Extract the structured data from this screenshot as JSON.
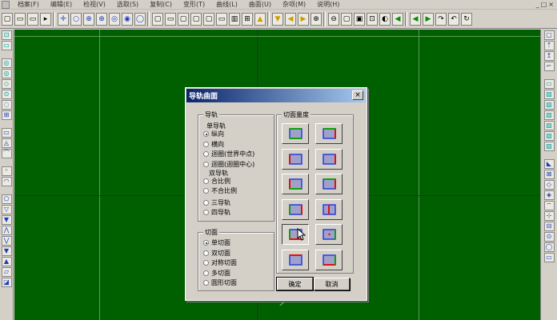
{
  "menu": {
    "items": [
      "档案(F)",
      "编辑(E)",
      "检视(V)",
      "选取(S)",
      "复制(C)",
      "变形(T)",
      "曲线(L)",
      "曲面(U)",
      "杂项(M)",
      "说明(H)"
    ],
    "window_controls": [
      "_",
      "□",
      "×"
    ]
  },
  "toolbar": {
    "buttons": [
      "▢",
      "▭",
      "▭",
      "▸",
      "✛",
      "○",
      "⊕",
      "⊕",
      "◎",
      "◉",
      "◯",
      "▢",
      "▭",
      "▢",
      "▢",
      "▢",
      "▭",
      "▥",
      "⊞",
      "▲",
      "▼",
      "◀",
      "▶",
      "⊕",
      "⊖",
      "▢",
      "▣",
      "⊡",
      "◐",
      "◀",
      "◀",
      "▶",
      "↷",
      "↶",
      "↻"
    ]
  },
  "left_toolbar": {
    "buttons": [
      "⊡",
      "▭",
      "◎",
      "◎",
      "◇",
      "⊙",
      "◌",
      "⊞",
      "▭",
      "◬",
      "⌒",
      "⁺",
      "◠",
      "⬠",
      "▽",
      "▼",
      "⋀",
      "⋁",
      "▼",
      "▲",
      "▱",
      "◪"
    ]
  },
  "right_toolbar": {
    "buttons": [
      "▢",
      "⇡",
      "↥",
      "⌐",
      "▭",
      "▧",
      "▧",
      "▧",
      "▧",
      "▧",
      "▧",
      "◣",
      "⊠",
      "◇",
      "◈",
      "⌔",
      "⊹",
      "⊟",
      "⊙",
      "◯",
      "▭"
    ]
  },
  "dialog": {
    "title": "导轨曲面",
    "close_glyph": "×",
    "rail_group": {
      "legend": "导轨",
      "single_label": "单导轨",
      "single_options": [
        {
          "label": "纵向",
          "checked": true
        },
        {
          "label": "横向",
          "checked": false
        },
        {
          "label": "迴圈(世界中点)",
          "checked": false
        },
        {
          "label": "迴圈(迴圈中心)",
          "checked": false
        }
      ],
      "double_label": "双导轨",
      "double_options": [
        {
          "label": "合比例",
          "checked": false
        },
        {
          "label": "不合比例",
          "checked": false
        }
      ],
      "multi_options": [
        {
          "label": "三导轨",
          "checked": false
        },
        {
          "label": "四导轨",
          "checked": false
        }
      ]
    },
    "section_group": {
      "legend": "切面",
      "options": [
        {
          "label": "单切面",
          "checked": true
        },
        {
          "label": "双切面",
          "checked": false
        },
        {
          "label": "对称切面",
          "checked": false
        },
        {
          "label": "多切面",
          "checked": false
        },
        {
          "label": "圆形切面",
          "checked": false
        }
      ]
    },
    "scale_group": {
      "legend": "切面量度",
      "selected_index": 8,
      "count": 12
    },
    "ok_label": "确定",
    "cancel_label": "取消"
  },
  "colors": {
    "canvas": "#006000",
    "title_start": "#0a246a",
    "title_end": "#a6caf0",
    "shape_red": "#e01010",
    "shape_green": "#10a010",
    "shape_blue": "#2040e0",
    "shape_fill": "#a0a0c8"
  }
}
